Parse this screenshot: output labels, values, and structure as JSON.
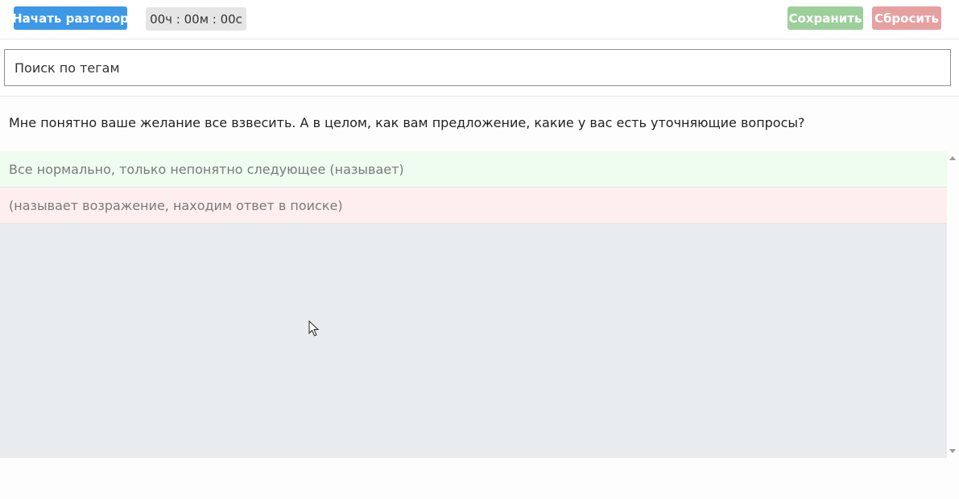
{
  "toolbar": {
    "start_label": "Начать разговор",
    "timer": "00ч : 00м : 00с",
    "save_label": "Сохранить",
    "reset_label": "Сбросить"
  },
  "search": {
    "placeholder": "Поиск по тегам"
  },
  "question": {
    "text": "Мне понятно ваше желание все взвесить. А в целом, как вам предложение, какие у вас есть уточняющие вопросы?"
  },
  "answers": [
    {
      "text": "Все нормально, только непонятно следующее (называет)",
      "tone": "positive"
    },
    {
      "text": "(называет возражение, находим ответ в поиске)",
      "tone": "negative"
    }
  ],
  "colors": {
    "start_button": "#3d98e8",
    "save_button": "#9ccf9a",
    "reset_button": "#e7a0a0",
    "positive_row": "#eefdf0",
    "negative_row": "#ffeef0",
    "answers_background": "#e9ecef"
  },
  "icons": {
    "scroll_up": "scroll-up-arrow-icon",
    "scroll_down": "scroll-down-arrow-icon",
    "cursor": "mouse-pointer-icon"
  }
}
